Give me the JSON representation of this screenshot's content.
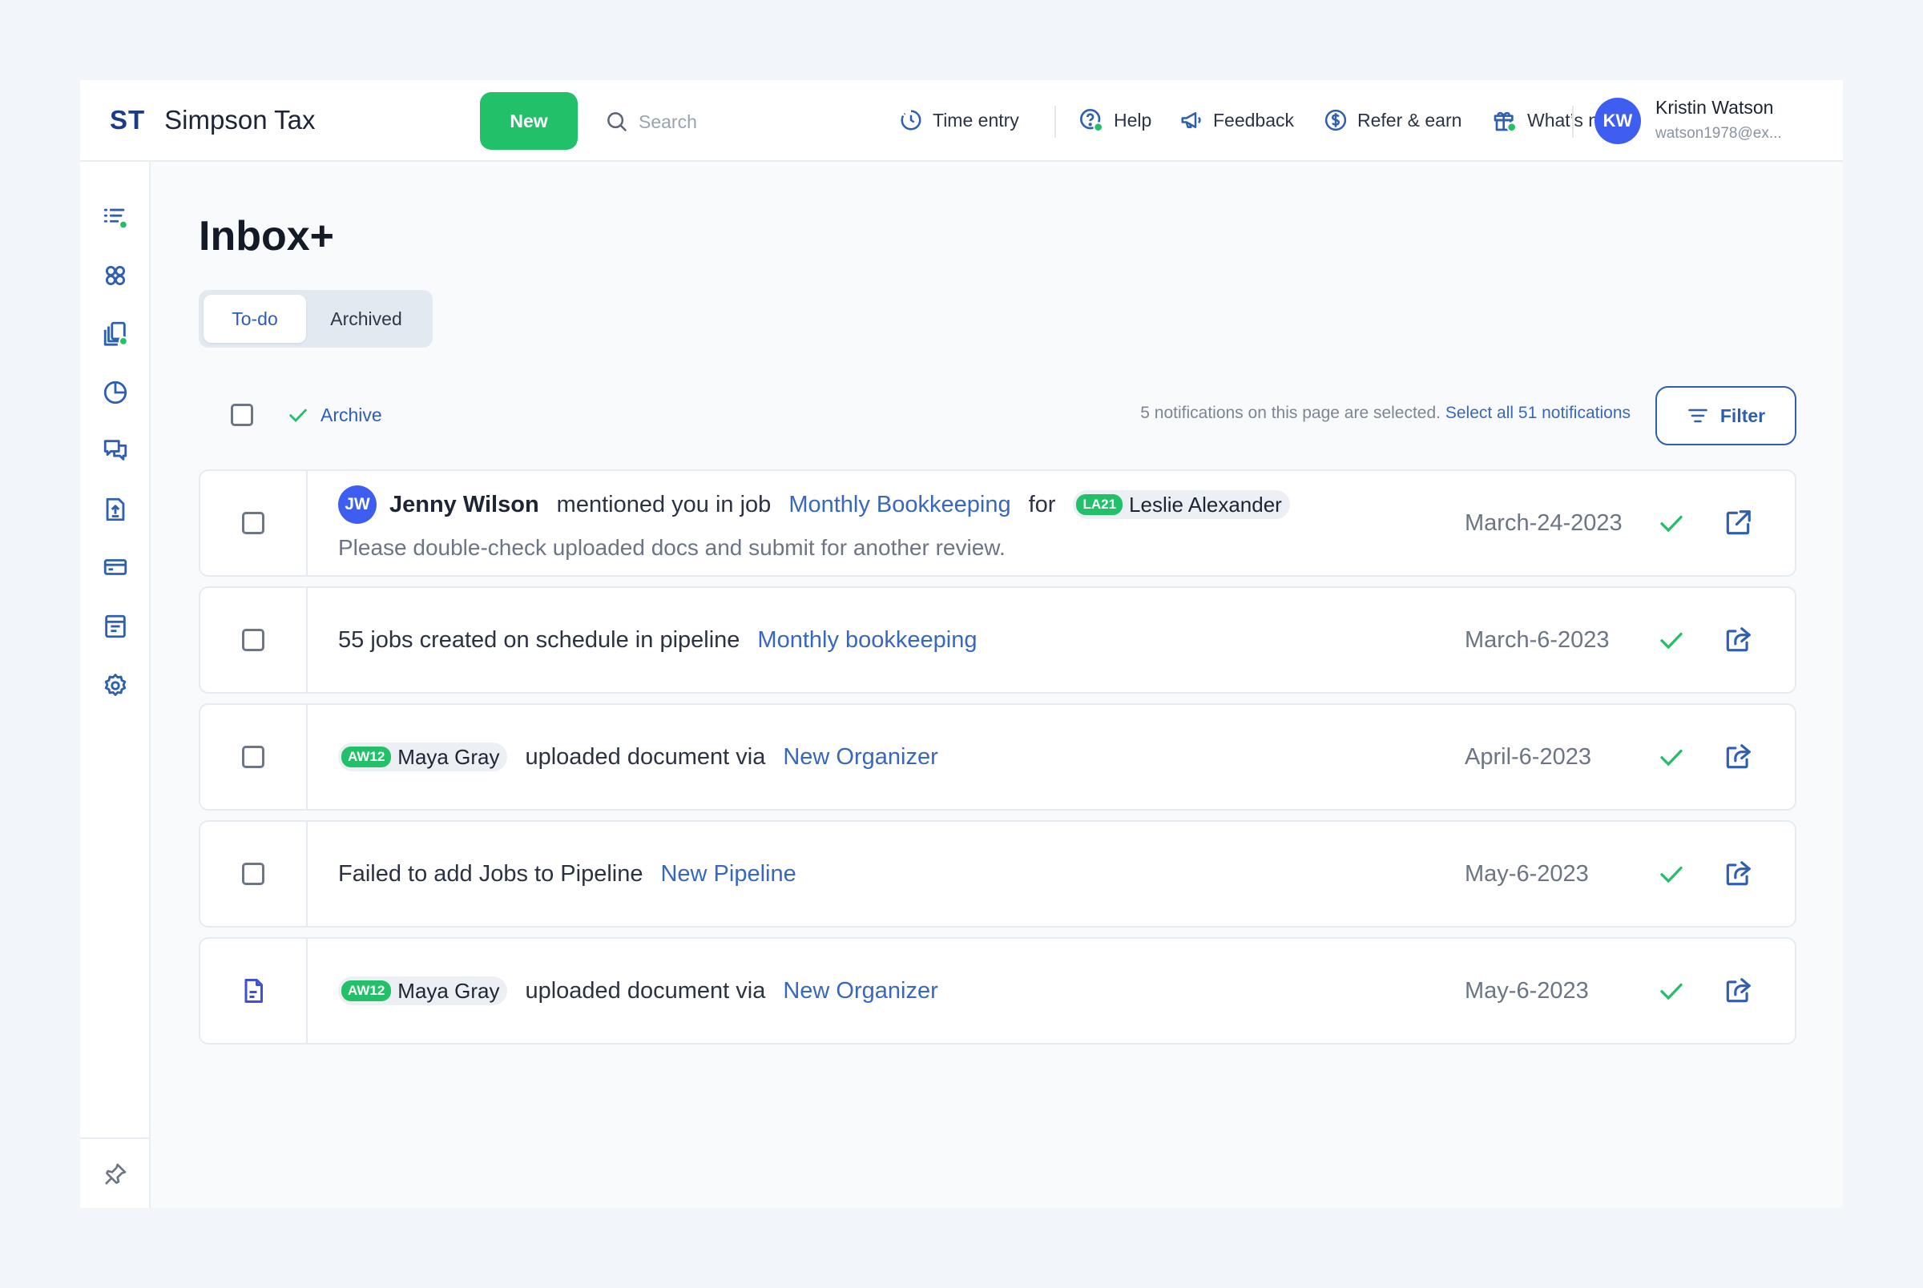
{
  "header": {
    "brand_mark": "ST",
    "brand_name": "Simpson Tax",
    "new_label": "New",
    "search_placeholder": "Search",
    "nav": {
      "time_entry": "Time entry",
      "help": "Help",
      "feedback": "Feedback",
      "refer": "Refer & earn",
      "whats_new": "What’s new"
    },
    "user": {
      "initials": "KW",
      "name": "Kristin Watson",
      "email": "watson1978@ex..."
    }
  },
  "page": {
    "title": "Inbox+",
    "tabs": [
      {
        "label": "To-do",
        "active": true
      },
      {
        "label": "Archived",
        "active": false
      }
    ],
    "toolbar": {
      "archive_label": "Archive",
      "selection_text": "5 notifications on this page are selected.",
      "select_all_label": "Select all 51 notifications",
      "filter_label": "Filter"
    }
  },
  "notifications": [
    {
      "avatar": "JW",
      "actor": "Jenny Wilson",
      "text": "mentioned you in job",
      "link": "Monthly Bookkeeping",
      "for_word": "for",
      "client_code": "LA21",
      "client_name": "Leslie Alexander",
      "message": "Please double-check uploaded docs and submit for another review.",
      "date": "March-24-2023"
    },
    {
      "text": "55 jobs created on schedule in pipeline",
      "link": "Monthly bookkeeping",
      "date": "March-6-2023"
    },
    {
      "client_code": "AW12",
      "client_name": "Maya Gray",
      "text": "uploaded document via",
      "link": "New Organizer",
      "date": "April-6-2023"
    },
    {
      "text": "Failed to add Jobs to Pipeline",
      "link": "New Pipeline",
      "date": "May-6-2023"
    },
    {
      "client_code": "AW12",
      "client_name": "Maya Gray",
      "text": "uploaded document via",
      "link": "New Organizer",
      "date": "May-6-2023"
    }
  ],
  "colors": {
    "accent_green": "#22c069",
    "link_blue": "#3767bf",
    "avatar_blue": "#3e5ef2"
  }
}
